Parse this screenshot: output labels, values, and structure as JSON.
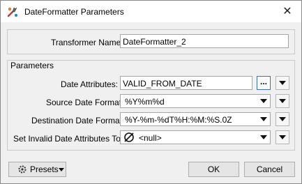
{
  "window": {
    "title": "DateFormatter Parameters",
    "close_icon": "close-icon",
    "app_icon": "fme-transformer-icon"
  },
  "transformer_name": {
    "label": "Transformer Name:",
    "value": "DateFormatter_2"
  },
  "parameters": {
    "group_title": "Parameters",
    "date_attributes": {
      "label": "Date Attributes:",
      "value": "VALID_FROM_DATE",
      "browse_label": "..."
    },
    "source_format": {
      "label": "Source Date Format:",
      "value": "%Y%m%d"
    },
    "destination_format": {
      "label": "Destination Date Format:",
      "value": "%Y-%m-%dT%H:%M:%S.0Z"
    },
    "invalid_to": {
      "label": "Set Invalid Date Attributes To:",
      "value": "<null>",
      "icon": "null-icon"
    }
  },
  "footer": {
    "presets_label": "Presets",
    "ok_label": "OK",
    "cancel_label": "Cancel"
  }
}
